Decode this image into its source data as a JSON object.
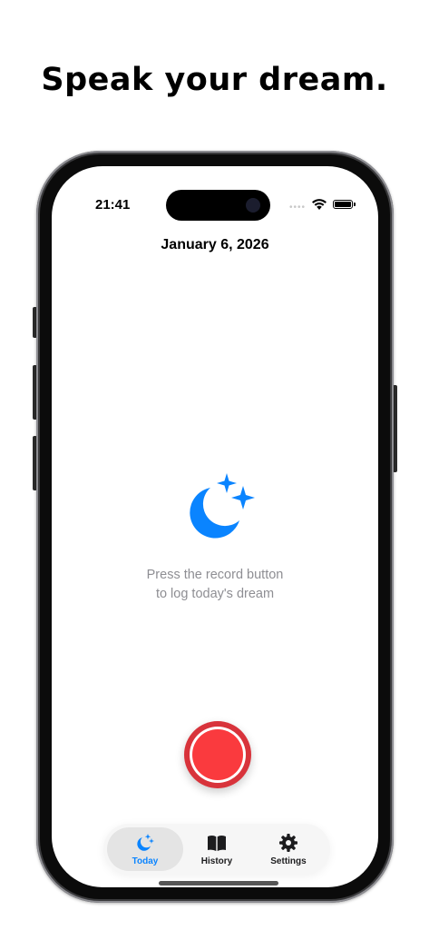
{
  "headline": "Speak your dream.",
  "status_bar": {
    "time": "21:41",
    "signal_dots": "••••"
  },
  "today": {
    "date": "January 6, 2026",
    "empty_line1": "Press the record button",
    "empty_line2": "to log today's dream"
  },
  "tabs": [
    {
      "label": "Today",
      "icon": "moon-stars-icon",
      "active": true
    },
    {
      "label": "History",
      "icon": "book-icon",
      "active": false
    },
    {
      "label": "Settings",
      "icon": "gear-icon",
      "active": false
    }
  ],
  "colors": {
    "accent": "#0a84ff",
    "record": "#fa3a3e",
    "hint_text": "#8e8e93"
  }
}
